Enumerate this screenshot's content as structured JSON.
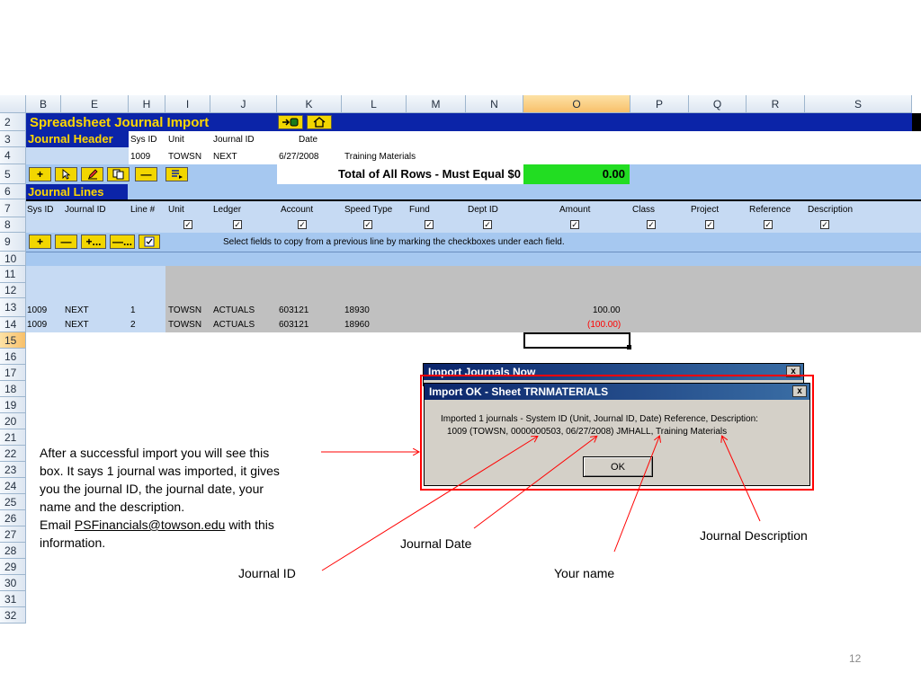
{
  "columns": [
    "B",
    "E",
    "H",
    "I",
    "J",
    "K",
    "L",
    "M",
    "N",
    "O",
    "P",
    "Q",
    "R",
    "S"
  ],
  "rows": [
    "2",
    "3",
    "4",
    "5",
    "6",
    "7",
    "8",
    "9",
    "10",
    "11",
    "12",
    "13",
    "14",
    "15",
    "16",
    "17",
    "18",
    "19",
    "20",
    "21",
    "22",
    "23",
    "24",
    "25",
    "26",
    "27",
    "28",
    "29",
    "30",
    "31",
    "32"
  ],
  "header": {
    "title": "Spreadsheet Journal Import",
    "journal_header": "Journal Header",
    "sys_id_label": "Sys ID",
    "unit_label": "Unit",
    "journal_id_label": "Journal ID",
    "date_label": "Date",
    "sys_id": "1009",
    "unit": "TOWSN",
    "journal_id": "NEXT",
    "date": "6/27/2008",
    "desc": "Training Materials",
    "total_label": "Total of All Rows - Must Equal $0",
    "total_value": "0.00",
    "journal_lines": "Journal Lines"
  },
  "toolbar1": {
    "plus": "+",
    "minus": "—"
  },
  "toolbar2": {
    "plus": "+",
    "minus": "—",
    "plus_dots": "+...",
    "minus_dots": "—..."
  },
  "copy_hint": "Select fields to copy from a previous line by marking the checkboxes under each field.",
  "line_headers": [
    "Sys ID",
    "Journal ID",
    "Line #",
    "Unit",
    "Ledger",
    "Account",
    "Speed Type",
    "Fund",
    "Dept ID",
    "Amount",
    "Class",
    "Project",
    "Reference",
    "Description"
  ],
  "lines": [
    {
      "sys": "1009",
      "jid": "NEXT",
      "line": "1",
      "unit": "TOWSN",
      "ledger": "ACTUALS",
      "account": "603121",
      "speed": "18930",
      "amount": "100.00"
    },
    {
      "sys": "1009",
      "jid": "NEXT",
      "line": "2",
      "unit": "TOWSN",
      "ledger": "ACTUALS",
      "account": "603121",
      "speed": "18960",
      "amount": "(100.00)"
    }
  ],
  "dialog_back": {
    "title": "Import Journals Now",
    "close": "x"
  },
  "dialog": {
    "title": "Import OK - Sheet TRNMATERIALS",
    "close": "x",
    "line1": "Imported  1 journals - System ID (Unit, Journal ID, Date) Reference, Description:",
    "line2": "1009 (TOWSN, 0000000503, 06/27/2008) JMHALL, Training Materials",
    "ok": "OK"
  },
  "annotations": {
    "explain_1": "After a successful import you will see this",
    "explain_2": "box.  It says 1 journal was imported, it gives",
    "explain_3": "you the journal ID, the journal date, your",
    "explain_4": "name and the description.",
    "email_prefix": "Email ",
    "email": "PSFinancials@towson.edu",
    "email_suffix": " with this",
    "explain_6": "information.",
    "journal_id": "Journal ID",
    "journal_date": "Journal Date",
    "your_name": "Your name",
    "journal_description": "Journal Description"
  },
  "page_number": "12",
  "colors": {
    "header_blue": "#0b24a8",
    "light_blue": "#a6c8f0",
    "row_blue": "#c6daf3",
    "gray": "#c0c0c0",
    "green": "#22dd22",
    "red": "#ff0000"
  }
}
